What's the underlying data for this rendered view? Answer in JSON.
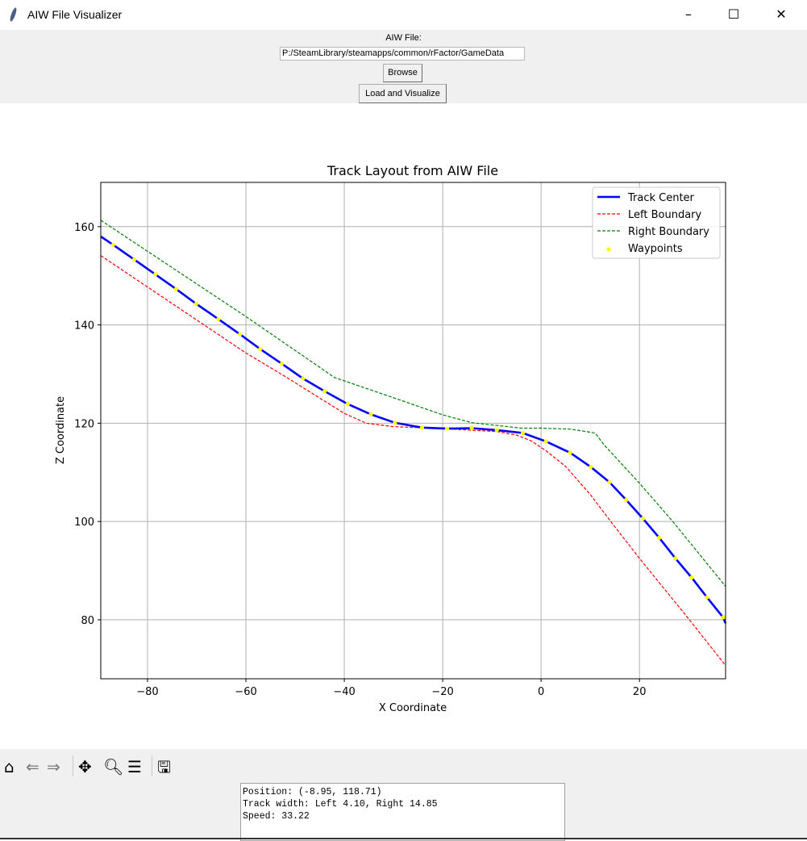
{
  "window": {
    "title": "AIW File Visualizer",
    "minimize": "–",
    "maximize": "☐",
    "close": "✕"
  },
  "controls": {
    "file_label": "AIW File:",
    "file_path": "P:/SteamLibrary/steamapps/common/rFactor/GameData",
    "browse_label": "Browse",
    "load_label": "Load and Visualize"
  },
  "toolbar": {
    "icons": [
      "home-icon",
      "back-icon",
      "forward-icon",
      "pan-icon",
      "zoom-icon",
      "configure-subplots-icon",
      "save-icon"
    ]
  },
  "info": {
    "position": "Position: (-8.95, 118.71)",
    "track_width": "Track width: Left 4.10, Right 14.85",
    "speed": "Speed: 33.22"
  },
  "chart_data": {
    "type": "line",
    "title": "Track Layout from AIW File",
    "xlabel": "X Coordinate",
    "ylabel": "Z Coordinate",
    "xlim": [
      -89.5,
      37.5
    ],
    "ylim": [
      68,
      169
    ],
    "xticks": [
      -80,
      -60,
      -40,
      -20,
      0,
      20
    ],
    "yticks": [
      80,
      100,
      120,
      140,
      160
    ],
    "grid": true,
    "legend_placement": "top-right",
    "series": [
      {
        "name": "Track Center",
        "color": "#0000ff",
        "style": "solid",
        "points": [
          [
            -89.5,
            158.0
          ],
          [
            -87.0,
            156.3
          ],
          [
            -82.7,
            153.3
          ],
          [
            -78.4,
            150.3
          ],
          [
            -74.2,
            147.3
          ],
          [
            -70.1,
            144.3
          ],
          [
            -65.6,
            141.2
          ],
          [
            -61.2,
            138.1
          ],
          [
            -57.1,
            135.1
          ],
          [
            -52.7,
            132.1
          ],
          [
            -48.4,
            129.1
          ],
          [
            -44.0,
            126.5
          ],
          [
            -39.3,
            123.9
          ],
          [
            -34.6,
            121.8
          ],
          [
            -29.7,
            120.1
          ],
          [
            -24.2,
            119.1
          ],
          [
            -19.1,
            118.9
          ],
          [
            -14.1,
            119.0
          ],
          [
            -9.0,
            118.6
          ],
          [
            -3.7,
            118.0
          ],
          [
            1.0,
            116.3
          ],
          [
            5.9,
            114.0
          ],
          [
            10.1,
            111.1
          ],
          [
            13.9,
            108.0
          ],
          [
            17.3,
            104.4
          ],
          [
            20.7,
            100.6
          ],
          [
            24.0,
            96.7
          ],
          [
            27.3,
            92.5
          ],
          [
            30.6,
            88.6
          ],
          [
            33.7,
            84.6
          ],
          [
            37.0,
            80.5
          ],
          [
            37.5,
            79.3
          ]
        ]
      },
      {
        "name": "Left Boundary",
        "color": "#ff0000",
        "style": "dashed",
        "points": [
          [
            -89.5,
            154.1
          ],
          [
            -60,
            134.3
          ],
          [
            -52,
            129.5
          ],
          [
            -44,
            124.5
          ],
          [
            -40,
            122
          ],
          [
            -35.5,
            120
          ],
          [
            -30,
            119.3
          ],
          [
            -20,
            118.9
          ],
          [
            -9,
            118.3
          ],
          [
            -5,
            117.6
          ],
          [
            -2,
            116.4
          ],
          [
            1,
            114.4
          ],
          [
            5,
            111.2
          ],
          [
            10,
            105.5
          ],
          [
            14,
            100.2
          ],
          [
            20,
            92.5
          ],
          [
            30,
            80.2
          ],
          [
            37.5,
            70.7
          ]
        ]
      },
      {
        "name": "Right Boundary",
        "color": "#008000",
        "style": "dashed",
        "points": [
          [
            -89.5,
            161.3
          ],
          [
            -60,
            141.7
          ],
          [
            -42,
            129.3
          ],
          [
            -28,
            124.5
          ],
          [
            -20,
            121.7
          ],
          [
            -14,
            120.1
          ],
          [
            -4,
            119
          ],
          [
            0,
            119
          ],
          [
            6,
            118.8
          ],
          [
            11,
            118
          ],
          [
            12.7,
            115.7
          ],
          [
            20,
            107.8
          ],
          [
            26.6,
            100.2
          ],
          [
            37.5,
            86.8
          ]
        ]
      },
      {
        "name": "Waypoints",
        "color": "#ffff00",
        "style": "scatter",
        "points": [
          [
            -87.0,
            156.3
          ],
          [
            -82.7,
            153.3
          ],
          [
            -78.4,
            150.3
          ],
          [
            -74.2,
            147.3
          ],
          [
            -70.1,
            144.3
          ],
          [
            -65.6,
            141.2
          ],
          [
            -61.2,
            138.1
          ],
          [
            -57.1,
            135.1
          ],
          [
            -52.7,
            132.1
          ],
          [
            -48.4,
            129.1
          ],
          [
            -44.0,
            126.5
          ],
          [
            -39.3,
            123.9
          ],
          [
            -34.6,
            121.8
          ],
          [
            -29.7,
            120.1
          ],
          [
            -24.2,
            119.1
          ],
          [
            -19.1,
            118.9
          ],
          [
            -14.1,
            119.0
          ],
          [
            -9.0,
            118.6
          ],
          [
            -3.7,
            118.0
          ],
          [
            1.0,
            116.3
          ],
          [
            5.9,
            114.0
          ],
          [
            10.1,
            111.1
          ],
          [
            13.9,
            108.0
          ],
          [
            17.3,
            104.4
          ],
          [
            20.7,
            100.6
          ],
          [
            24.0,
            96.7
          ],
          [
            27.3,
            92.5
          ],
          [
            30.6,
            88.6
          ],
          [
            33.7,
            84.6
          ],
          [
            37.0,
            80.5
          ]
        ]
      }
    ]
  }
}
